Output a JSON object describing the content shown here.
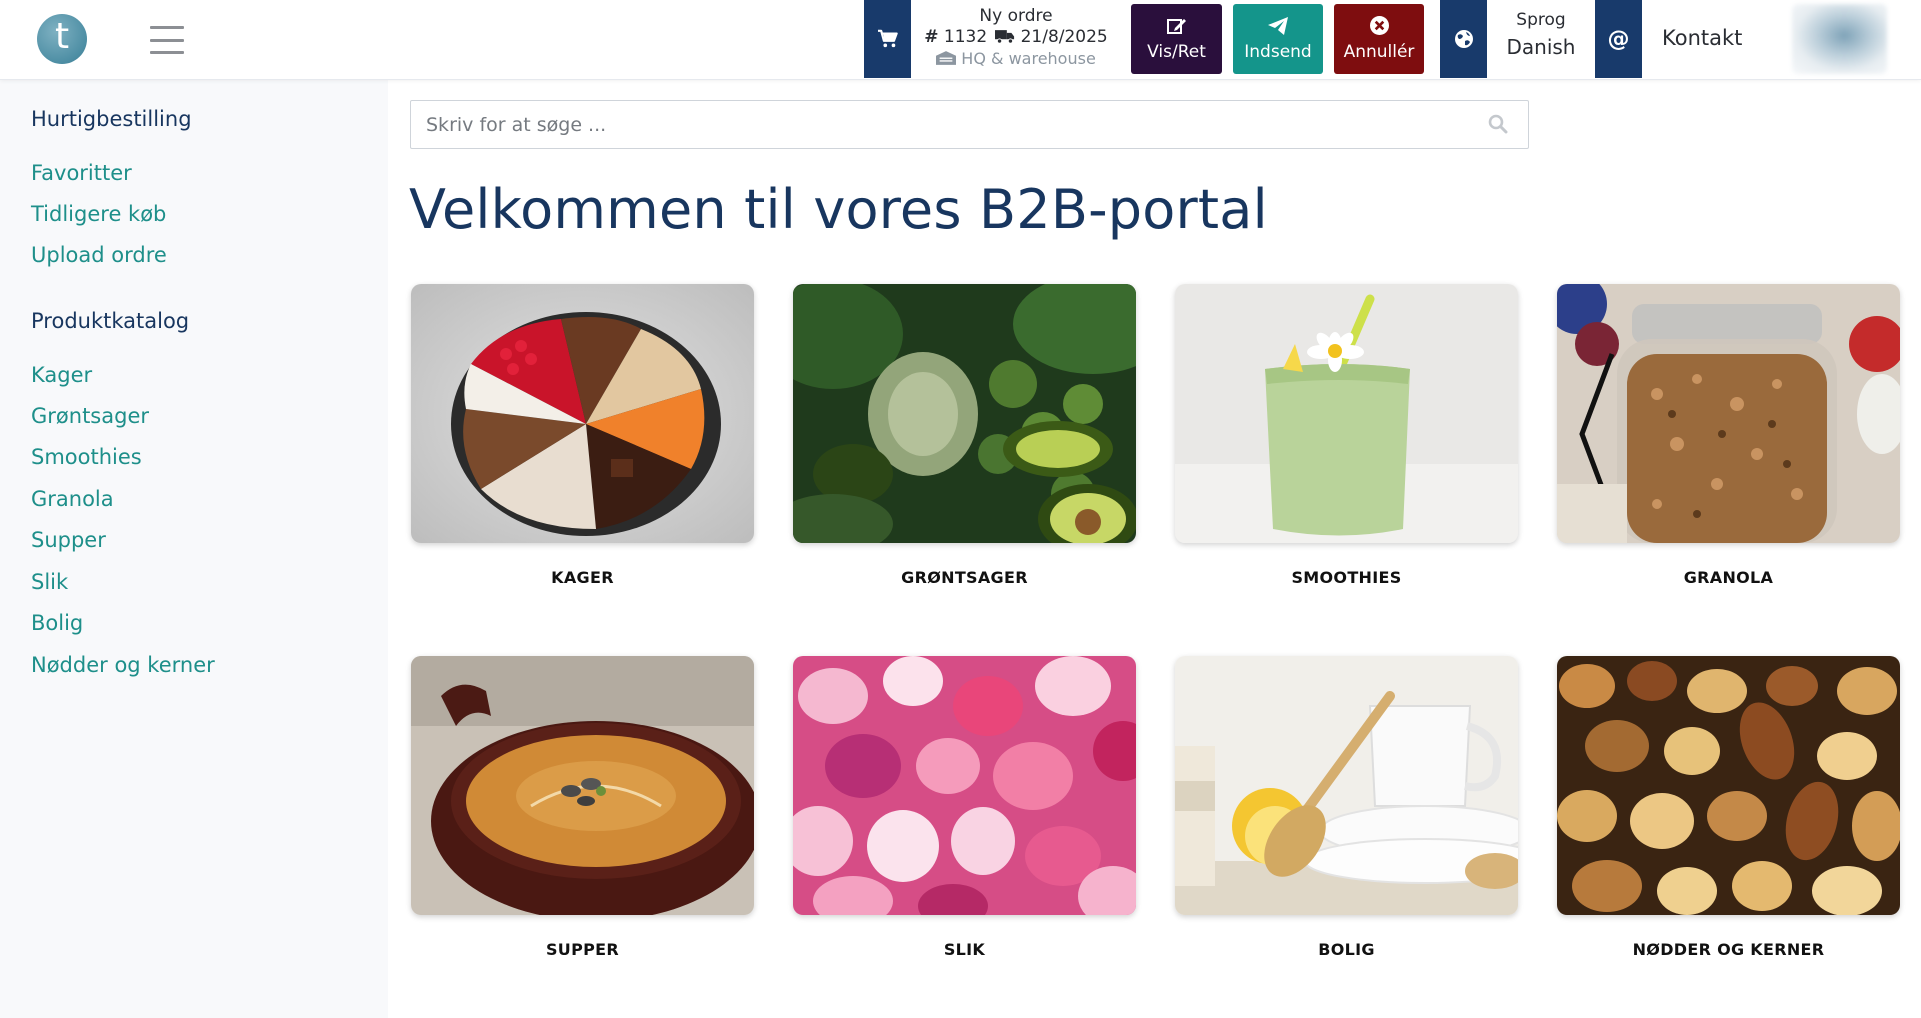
{
  "header": {
    "logo_letter": "t",
    "order": {
      "title": "Ny ordre",
      "number_symbol": "#",
      "number": "1132",
      "delivery_date": "21/8/2025",
      "warehouse": "HQ & warehouse"
    },
    "buttons": {
      "view_edit": "Vis/Ret",
      "submit": "Indsend",
      "cancel": "Annullér"
    },
    "language": {
      "label": "Sprog",
      "value": "Danish"
    },
    "contact_label": "Kontakt"
  },
  "search": {
    "placeholder": "Skriv for at søge ..."
  },
  "sidebar": {
    "quick_order_heading": "Hurtigbestilling",
    "quick_links": [
      "Favoritter",
      "Tidligere køb",
      "Upload ordre"
    ],
    "catalog_heading": "Produktkatalog",
    "catalog_links": [
      "Kager",
      "Grøntsager",
      "Smoothies",
      "Granola",
      "Supper",
      "Slik",
      "Bolig",
      "Nødder og kerner"
    ]
  },
  "main": {
    "welcome": "Velkommen til vores B2B-portal",
    "categories": [
      {
        "label": "KAGER",
        "image": "cake-slices-image"
      },
      {
        "label": "GRØNTSAGER",
        "image": "vegetables-image"
      },
      {
        "label": "SMOOTHIES",
        "image": "smoothie-image"
      },
      {
        "label": "GRANOLA",
        "image": "granola-jar-image"
      },
      {
        "label": "SUPPER",
        "image": "soup-bowl-image"
      },
      {
        "label": "SLIK",
        "image": "candy-image"
      },
      {
        "label": "BOLIG",
        "image": "home-cleaning-image"
      },
      {
        "label": "NØDDER OG KERNER",
        "image": "nuts-image"
      }
    ]
  },
  "colors": {
    "navy": "#183a6b",
    "teal": "#14958b",
    "dark_purple": "#2a0f3c",
    "dark_red": "#7e0d0f",
    "link_teal": "#1e8f8a",
    "heading_navy": "#18365f",
    "sidebar_bg": "#f8f9fb"
  }
}
